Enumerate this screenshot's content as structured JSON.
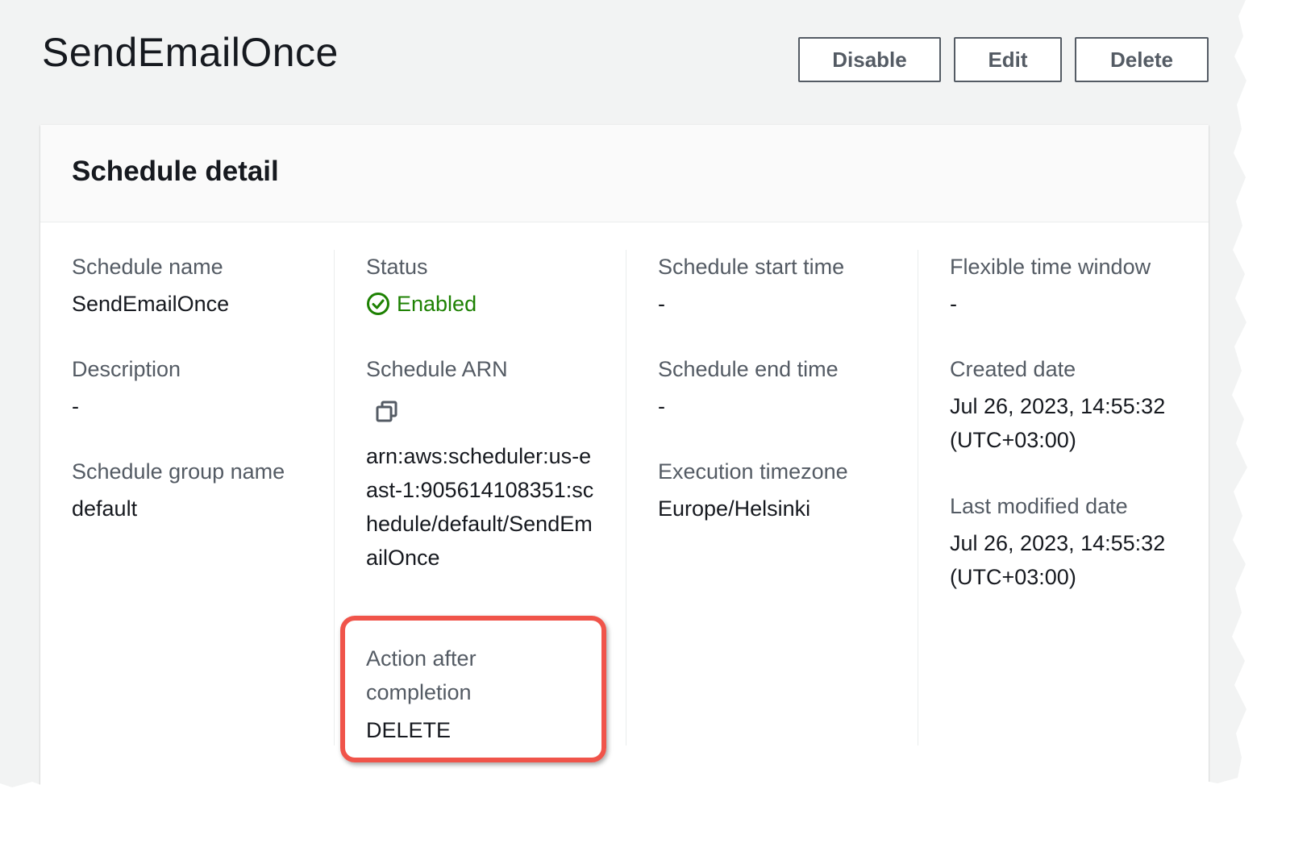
{
  "page": {
    "title": "SendEmailOnce",
    "actions": {
      "disable_label": "Disable",
      "edit_label": "Edit",
      "delete_label": "Delete"
    }
  },
  "panel": {
    "title": "Schedule detail",
    "columns": [
      {
        "fields": [
          {
            "label": "Schedule name",
            "value": "SendEmailOnce"
          },
          {
            "label": "Description",
            "value": "-"
          },
          {
            "label": "Schedule group name",
            "value": "default"
          }
        ]
      },
      {
        "fields": [
          {
            "label": "Status",
            "value": "Enabled",
            "icon": "check-circle-icon",
            "color": "#1d8102"
          },
          {
            "label": "Schedule ARN",
            "value": "arn:aws:scheduler:us-east-1:905614108351:schedule/default/SendEmailOnce",
            "icon": "copy-icon"
          },
          {
            "label": "Action after completion",
            "value": "DELETE"
          }
        ]
      },
      {
        "fields": [
          {
            "label": "Schedule start time",
            "value": "-"
          },
          {
            "label": "Schedule end time",
            "value": "-"
          },
          {
            "label": "Execution timezone",
            "value": "Europe/Helsinki"
          }
        ]
      },
      {
        "fields": [
          {
            "label": "Flexible time window",
            "value": "-"
          },
          {
            "label": "Created date",
            "value": "Jul 26, 2023, 14:55:32 (UTC+03:00)"
          },
          {
            "label": "Last modified date",
            "value": "Jul 26, 2023, 14:55:32 (UTC+03:00)"
          }
        ]
      }
    ]
  },
  "annotation": {
    "highlight_color": "#f0544a"
  }
}
